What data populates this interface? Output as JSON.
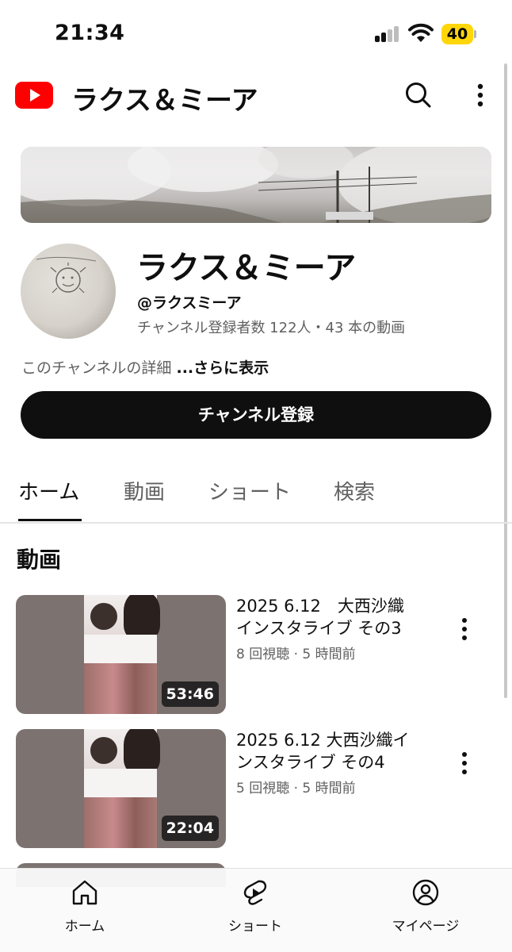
{
  "status_bar": {
    "time": "21:34",
    "battery_percent": "40"
  },
  "header": {
    "title": "ラクス＆ミーア"
  },
  "channel": {
    "name": "ラクス＆ミーア",
    "handle": "@ラクスミーア",
    "stats": "チャンネル登録者数 122人・43 本の動画",
    "description": "このチャンネルの詳細 ",
    "more_link": "...さらに表示",
    "subscribe_label": "チャンネル登録"
  },
  "tabs": [
    {
      "label": "ホーム",
      "active": true
    },
    {
      "label": "動画",
      "active": false
    },
    {
      "label": "ショート",
      "active": false
    },
    {
      "label": "検索",
      "active": false
    }
  ],
  "section_title": "動画",
  "videos": [
    {
      "title_line1": "2025 6.12　大西沙織",
      "title_line2": "インスタライブ その3",
      "meta": "8 回視聴 · 5 時間前",
      "duration": "53:46"
    },
    {
      "title_line1": "2025 6.12 大西沙織イ",
      "title_line2": "ンスタライブ その4",
      "meta": "5 回視聴 · 5 時間前",
      "duration": "22:04"
    }
  ],
  "bottom_nav": [
    {
      "label": "ホーム",
      "icon": "home-icon"
    },
    {
      "label": "ショート",
      "icon": "shorts-icon"
    },
    {
      "label": "マイページ",
      "icon": "profile-icon"
    }
  ],
  "colors": {
    "brand_red": "#ff0000",
    "subscribe_bg": "#0f0f0f",
    "battery": "#ffd60a",
    "secondary_text": "#606060"
  }
}
